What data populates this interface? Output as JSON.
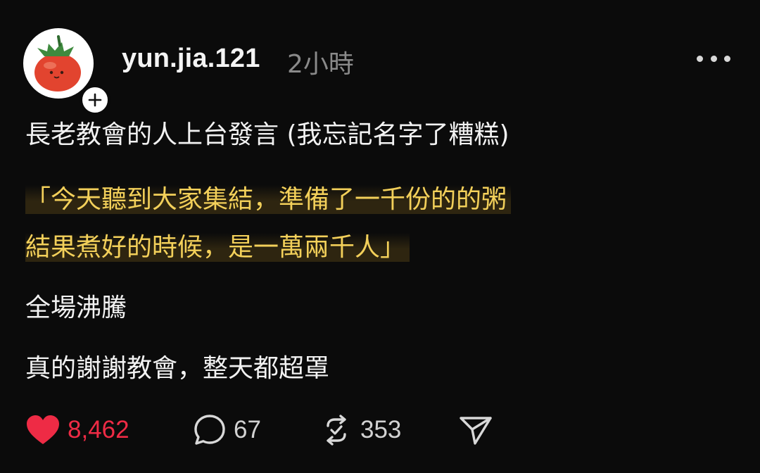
{
  "post": {
    "username": "yun.jia.121",
    "timestamp": "2小時",
    "lines": [
      "長老教會的人上台發言 (我忘記名字了糟糕)",
      "「今天聽到大家集結，準備了一千份的的粥",
      "結果煮好的時候，是一萬兩千人」",
      "全場沸騰",
      "真的謝謝教會，整天都超罩"
    ]
  },
  "actions": {
    "likes": "8,462",
    "replies": "67",
    "reposts": "353"
  },
  "icons": {
    "avatar": "tomato-avatar-icon",
    "follow": "plus-icon",
    "more": "more-options-icon",
    "like": "heart-icon",
    "reply": "comment-bubble-icon",
    "repost": "repost-icon",
    "share": "send-icon"
  },
  "colors": {
    "background": "#0b0b0b",
    "like_active": "#ee2b45",
    "highlight_text": "#f3d05a",
    "muted": "#8a8a8a"
  }
}
